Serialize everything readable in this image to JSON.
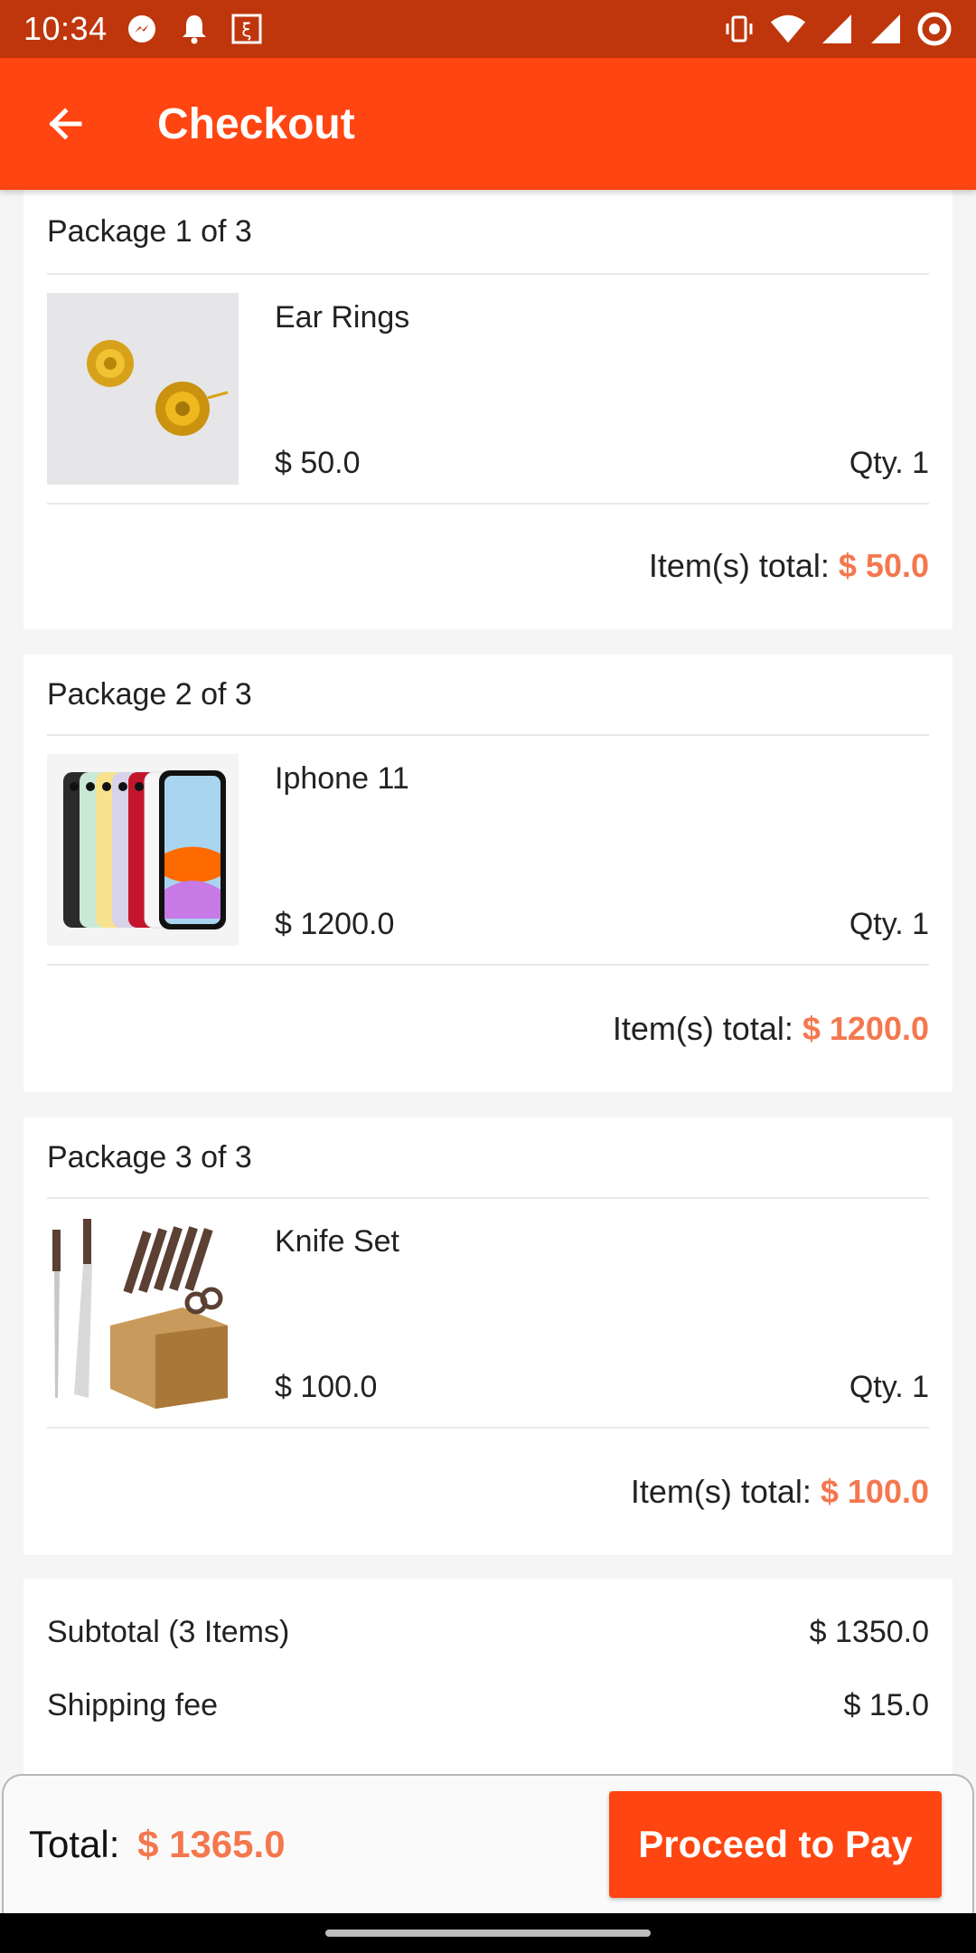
{
  "status_bar": {
    "time": "10:34",
    "icons_left": [
      "messenger-icon",
      "notification-bell-icon",
      "app-icon"
    ],
    "icons_right": [
      "vibrate-icon",
      "wifi-icon",
      "signal-icon",
      "signal-icon",
      "target-icon"
    ]
  },
  "app_bar": {
    "title": "Checkout",
    "back_icon": "arrow-back-icon",
    "color": "#ff4511"
  },
  "packages": [
    {
      "header": "Package 1 of 3",
      "item": {
        "name": "Ear Rings",
        "price": "$ 50.0",
        "qty": "Qty. 1",
        "image": "gold-rose-earrings-image"
      },
      "total_label": "Item(s) total:",
      "total_value": "$ 50.0"
    },
    {
      "header": "Package 2 of 3",
      "item": {
        "name": "Iphone 11",
        "price": "$ 1200.0",
        "qty": "Qty. 1",
        "image": "iphone-11-colors-image"
      },
      "total_label": "Item(s) total:",
      "total_value": "$ 1200.0"
    },
    {
      "header": "Package 3 of 3",
      "item": {
        "name": "Knife Set",
        "price": "$ 100.0",
        "qty": "Qty. 1",
        "image": "knife-block-set-image"
      },
      "total_label": "Item(s) total:",
      "total_value": "$ 100.0"
    }
  ],
  "summary": {
    "subtotal_label": "Subtotal (3 Items)",
    "subtotal_value": "$ 1350.0",
    "shipping_label": "Shipping fee",
    "shipping_value": "$ 15.0"
  },
  "bottom_bar": {
    "total_label": "Total:",
    "total_value": "$ 1365.0",
    "pay_button": "Proceed to Pay"
  },
  "colors": {
    "primary": "#ff4511",
    "status_bar": "#bf360c",
    "price_accent": "#f4774e"
  }
}
